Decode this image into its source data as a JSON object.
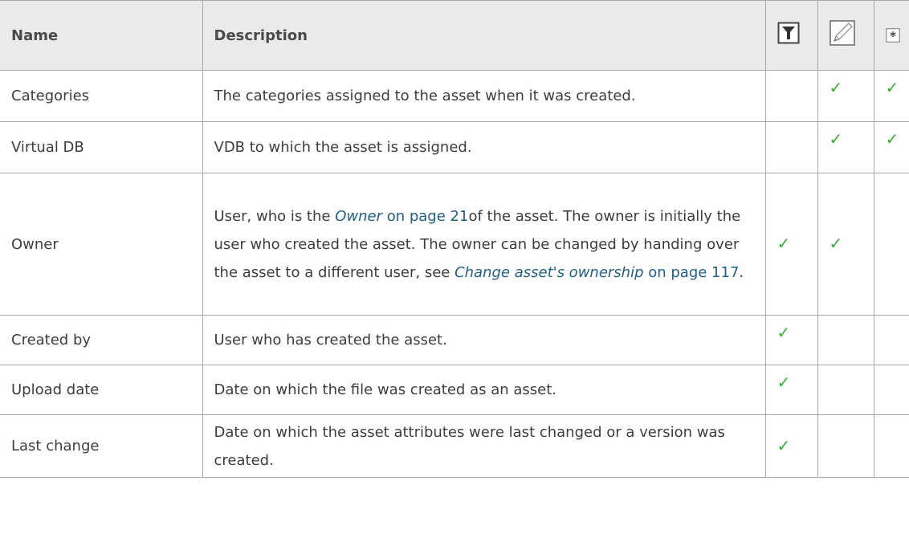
{
  "headers": {
    "name": "Name",
    "description": "Description",
    "col_filter_icon": "filter-icon",
    "col_edit_icon": "pencil-icon",
    "col_required_icon": "asterisk-icon"
  },
  "check_glyph": "✓",
  "rows": [
    {
      "name": "Categories",
      "description": "The categories assigned to the asset when it was created.",
      "filter": false,
      "edit": true,
      "required": true
    },
    {
      "name": "Virtual DB",
      "description": "VDB to which the asset is assigned.",
      "filter": false,
      "edit": true,
      "required": true
    },
    {
      "name": "Owner",
      "desc_part1": "User, who is the ",
      "desc_link1": "Owner",
      "desc_link1_page": " on page 21",
      "desc_part2": "of the asset. The owner is initially the user who created the asset. The owner can be changed by handing over the asset to a different user, see ",
      "desc_link2": "Change asset's ownership",
      "desc_link2_page": " on page 117",
      "desc_end": ".",
      "filter": true,
      "edit": true,
      "required": false
    },
    {
      "name": "Created by",
      "description": "User who has created the asset.",
      "filter": true,
      "edit": false,
      "required": false
    },
    {
      "name": "Upload date",
      "description": "Date on which the file was created as an asset.",
      "filter": true,
      "edit": false,
      "required": false
    },
    {
      "name": "Last change",
      "description": "Date on which the asset attributes were last changed or a version was created.",
      "filter": true,
      "edit": false,
      "required": false
    }
  ],
  "colors": {
    "check": "#35b035",
    "link": "#1f5f86",
    "header_bg": "#eaeaea",
    "border": "#a8a8a8"
  }
}
